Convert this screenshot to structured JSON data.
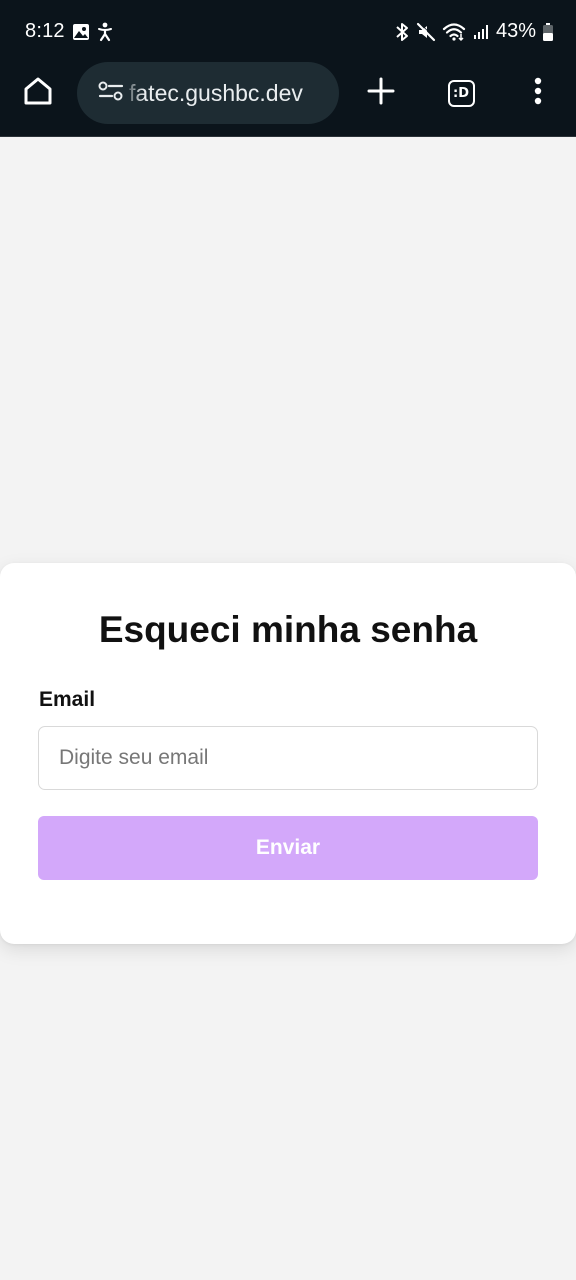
{
  "status_bar": {
    "time": "8:12",
    "battery": "43%",
    "icons_left": [
      "gallery-icon",
      "accessibility-icon"
    ],
    "icons_right": [
      "bluetooth-icon",
      "mute-icon",
      "wifi-icon",
      "signal-icon",
      "battery-icon"
    ]
  },
  "browser": {
    "url": "fatec.gushbc.dev",
    "tabs_label": ":D"
  },
  "form": {
    "title": "Esqueci minha senha",
    "email_label": "Email",
    "email_placeholder": "Digite seu email",
    "email_value": "",
    "submit_label": "Enviar"
  },
  "colors": {
    "chrome_bg": "#0b141b",
    "url_pill_bg": "#1e2c33",
    "page_bg": "#f3f3f3",
    "card_bg": "#ffffff",
    "button_bg": "#d3a8fa",
    "button_text": "#ffffff"
  }
}
